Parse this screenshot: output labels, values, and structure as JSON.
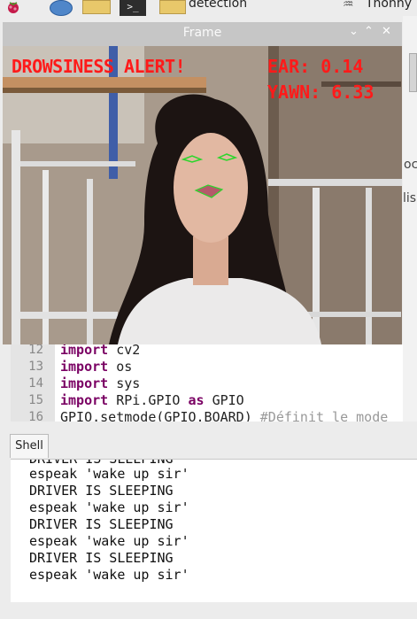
{
  "taskbar": {
    "icons": [
      "raspberry-icon",
      "globe-icon",
      "folder-icon",
      "terminal-icon",
      "folder-icon"
    ],
    "terminal_glyph": ">_",
    "folder_window_label": "detection",
    "thonny_label": "Thonny"
  },
  "frame": {
    "title": "Frame",
    "overlay": {
      "alert": "DROWSINESS ALERT!",
      "ear": "EAR: 0.14",
      "yawn": "YAWN: 6.33"
    },
    "overlay_color": "#ff1a1a",
    "landmark_color": "#2bd62b"
  },
  "background": {
    "fragment1": "oca",
    "fragment2": "lis"
  },
  "editor": {
    "lines": [
      {
        "num": "12",
        "kw": "import",
        "rest": " cv2"
      },
      {
        "num": "13",
        "kw": "import",
        "rest": " os"
      },
      {
        "num": "14",
        "kw": "import",
        "rest": " sys"
      },
      {
        "num": "15",
        "kw": "import",
        "rest": " RPi.GPIO ",
        "kw2": "as",
        "rest2": " GPIO"
      },
      {
        "num": "16",
        "plain": "GPIO.setmode(GPIO.BOARD) ",
        "comment": "#Définit le mode"
      }
    ],
    "keyword_color": "#7a0063"
  },
  "shell": {
    "tab_label": "Shell",
    "lines": [
      "DRIVER IS SLEEPING",
      "espeak 'wake up sir'",
      "DRIVER IS SLEEPING",
      "espeak 'wake up sir'",
      "DRIVER IS SLEEPING",
      "espeak 'wake up sir'",
      "DRIVER IS SLEEPING",
      "espeak 'wake up sir'"
    ]
  }
}
